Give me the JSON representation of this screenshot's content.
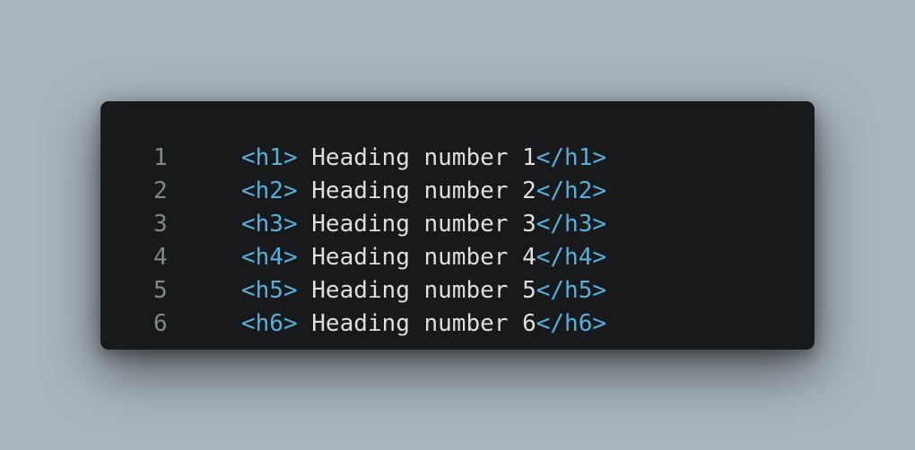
{
  "colors": {
    "background": "#a9b4bd",
    "editor_background": "#18191b",
    "line_number": "#7c8b86",
    "tag": "#56b0dc",
    "text": "#dedede"
  },
  "code": {
    "lines": [
      {
        "number": "1",
        "open_tag": "<h1>",
        "text": " Heading number 1",
        "close_tag": "</h1>"
      },
      {
        "number": "2",
        "open_tag": "<h2>",
        "text": " Heading number 2",
        "close_tag": "</h2>"
      },
      {
        "number": "3",
        "open_tag": "<h3>",
        "text": " Heading number 3",
        "close_tag": "</h3>"
      },
      {
        "number": "4",
        "open_tag": "<h4>",
        "text": " Heading number 4",
        "close_tag": "</h4>"
      },
      {
        "number": "5",
        "open_tag": "<h5>",
        "text": " Heading number 5",
        "close_tag": "</h5>"
      },
      {
        "number": "6",
        "open_tag": "<h6>",
        "text": " Heading number 6",
        "close_tag": "</h6>"
      }
    ]
  }
}
